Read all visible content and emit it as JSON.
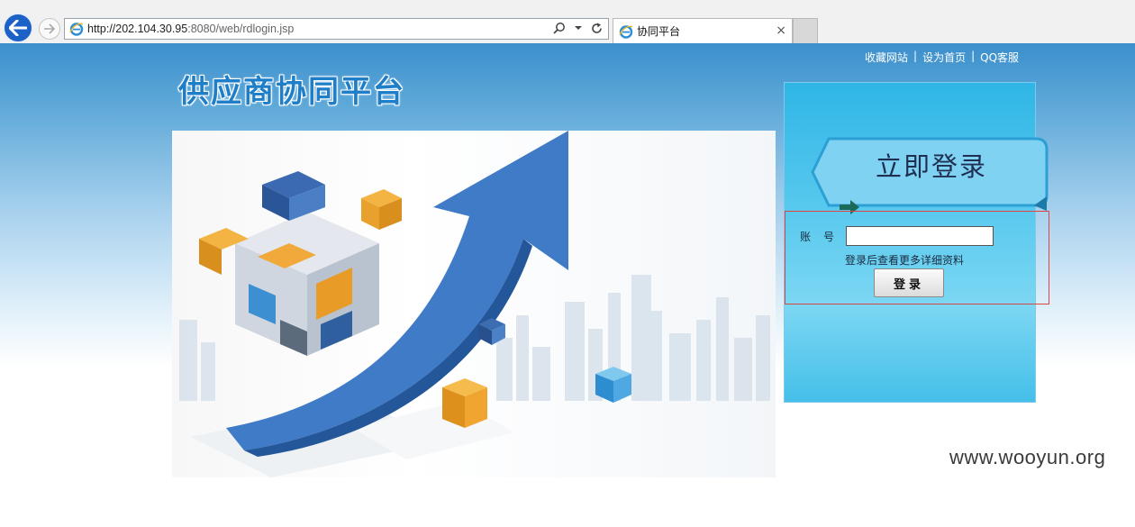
{
  "browser": {
    "url_main": "http://202.104.30.95",
    "url_rest": ":8080/web/rdlogin.jsp",
    "tab_title": "协同平台",
    "tab_close": "×"
  },
  "page": {
    "top_links": [
      "收藏网站",
      "设为首页",
      "QQ客服"
    ],
    "separator": "|",
    "logo_text": "供应商协同平台"
  },
  "login": {
    "header": "立即登录",
    "account_label": "账号",
    "account_value": "",
    "hint": "登录后查看更多详细资料",
    "submit_label": "登录"
  },
  "watermark": "www.wooyun.org",
  "colors": {
    "brand_blue": "#1e7ec8",
    "panel_blue": "#45bfe9",
    "highlight_border": "#dd4444"
  }
}
